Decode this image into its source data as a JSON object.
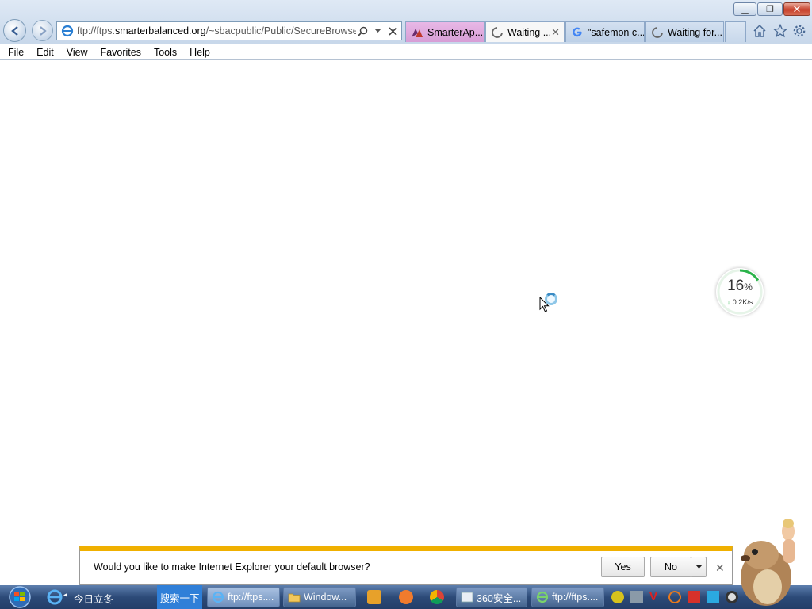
{
  "browser": {
    "address_prefix": "ftp://ftps.",
    "address_domain": "smarterbalanced.org",
    "address_path": "/~sbacpublic/Public/SecureBrowsers",
    "tabs": [
      {
        "label": "SmarterAp..."
      },
      {
        "label": "Waiting ..."
      },
      {
        "label": "\"safemon c..."
      },
      {
        "label": "Waiting for..."
      }
    ]
  },
  "menu": {
    "file": "File",
    "edit": "Edit",
    "view": "View",
    "favorites": "Favorites",
    "tools": "Tools",
    "help": "Help"
  },
  "speed_widget": {
    "percent": "16",
    "percent_sign": "%",
    "rate": "0.2K/s",
    "progress_fraction": 0.16
  },
  "notification": {
    "message": "Would you like to make Internet Explorer your default browser?",
    "yes": "Yes",
    "no": "No"
  },
  "taskbar": {
    "label": "今日立冬",
    "search": "搜索一下",
    "items": [
      {
        "label": "ftp://ftps...."
      },
      {
        "label": "Window..."
      },
      {
        "label": "360安全..."
      },
      {
        "label": "ftp://ftps...."
      }
    ]
  },
  "colors": {
    "notify_accent": "#f0b000",
    "tab_active_pink": "#d79ed6",
    "progress_green": "#2bb34a",
    "taskbar": "#2c4a78"
  }
}
